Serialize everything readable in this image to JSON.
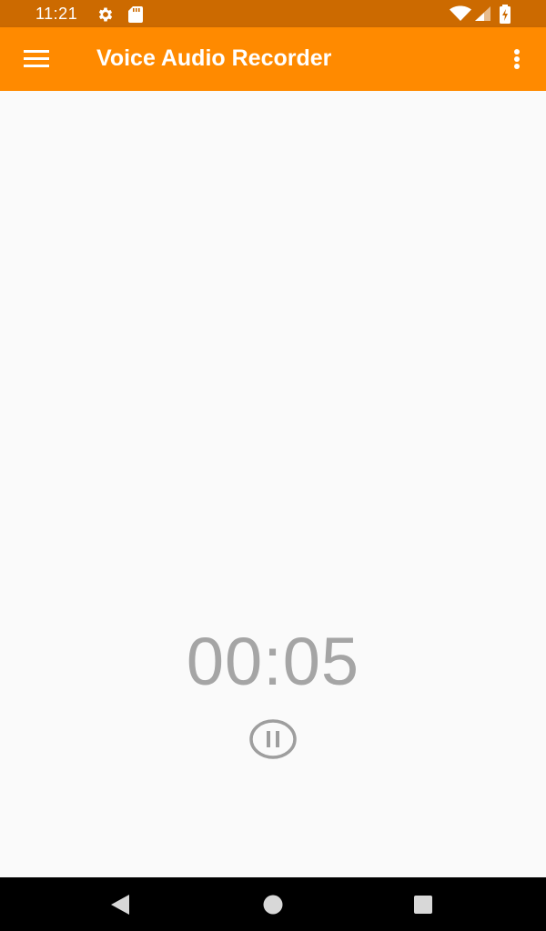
{
  "status_bar": {
    "time": "11:21",
    "icons": [
      "settings-gear-icon",
      "sd-card-icon",
      "wifi-icon",
      "cell-signal-icon",
      "battery-charging-icon"
    ]
  },
  "app_bar": {
    "title": "Voice Audio Recorder",
    "left_icon": "hamburger-menu-icon",
    "right_icon": "overflow-menu-icon"
  },
  "recorder": {
    "elapsed": "00:05",
    "control_icon": "pause-icon"
  },
  "nav_bar": {
    "icons": [
      "back-icon",
      "home-icon",
      "recents-icon"
    ]
  },
  "colors": {
    "status_bar": "#cc6a00",
    "app_bar": "#ff8a00",
    "background": "#fafafa",
    "timer_text": "#a5a5a5",
    "nav_bar": "#000000"
  }
}
